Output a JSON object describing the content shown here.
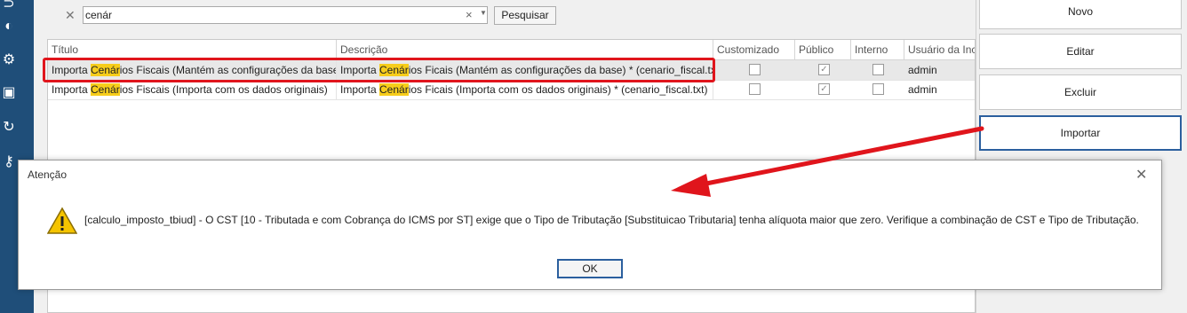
{
  "colors": {
    "sidebar": "#1f4e79",
    "highlight": "#f7cd1a",
    "annotation_red": "#e0151c",
    "focus_border": "#2b5f9e"
  },
  "sidebar": {
    "icons": [
      "app-icon",
      "contrast-icon",
      "user-settings-icon",
      "monitor-lock-icon",
      "sync-icon",
      "key-icon"
    ]
  },
  "search": {
    "value": "cenár",
    "button": "Pesquisar"
  },
  "table": {
    "columns": [
      "Título",
      "Descrição",
      "Customizado",
      "Público",
      "Interno",
      "Usuário da Inc"
    ],
    "rows": [
      {
        "titulo": {
          "before": "Importa ",
          "match": "Cenár",
          "after": "ios Fiscais (Mantém as configurações da base)"
        },
        "descricao": {
          "before": "Importa ",
          "match": "Cenár",
          "after": "ios Ficais (Mantém as configurações da base) * (cenario_fiscal.txt)"
        },
        "customizado": false,
        "publico": true,
        "interno": false,
        "usuario": "admin"
      },
      {
        "titulo": {
          "before": "Importa ",
          "match": "Cenár",
          "after": "ios Fiscais (Importa com os dados originais)"
        },
        "descricao": {
          "before": "Importa ",
          "match": "Cenár",
          "after": "ios Ficais (Importa com os dados originais) * (cenario_fiscal.txt)"
        },
        "customizado": false,
        "publico": true,
        "interno": false,
        "usuario": "admin"
      }
    ]
  },
  "buttons": {
    "novo": "Novo",
    "editar": "Editar",
    "excluir": "Excluir",
    "importar": "Importar"
  },
  "dialog": {
    "title": "Atenção",
    "message": "[calculo_imposto_tbiud] - O CST [10 - Tributada e com Cobrança do ICMS por ST] exige que o Tipo de Tributação [Substituicao Tributaria] tenha alíquota maior que zero. Verifique a combinação de CST e Tipo de Tributação.",
    "ok": "OK"
  }
}
